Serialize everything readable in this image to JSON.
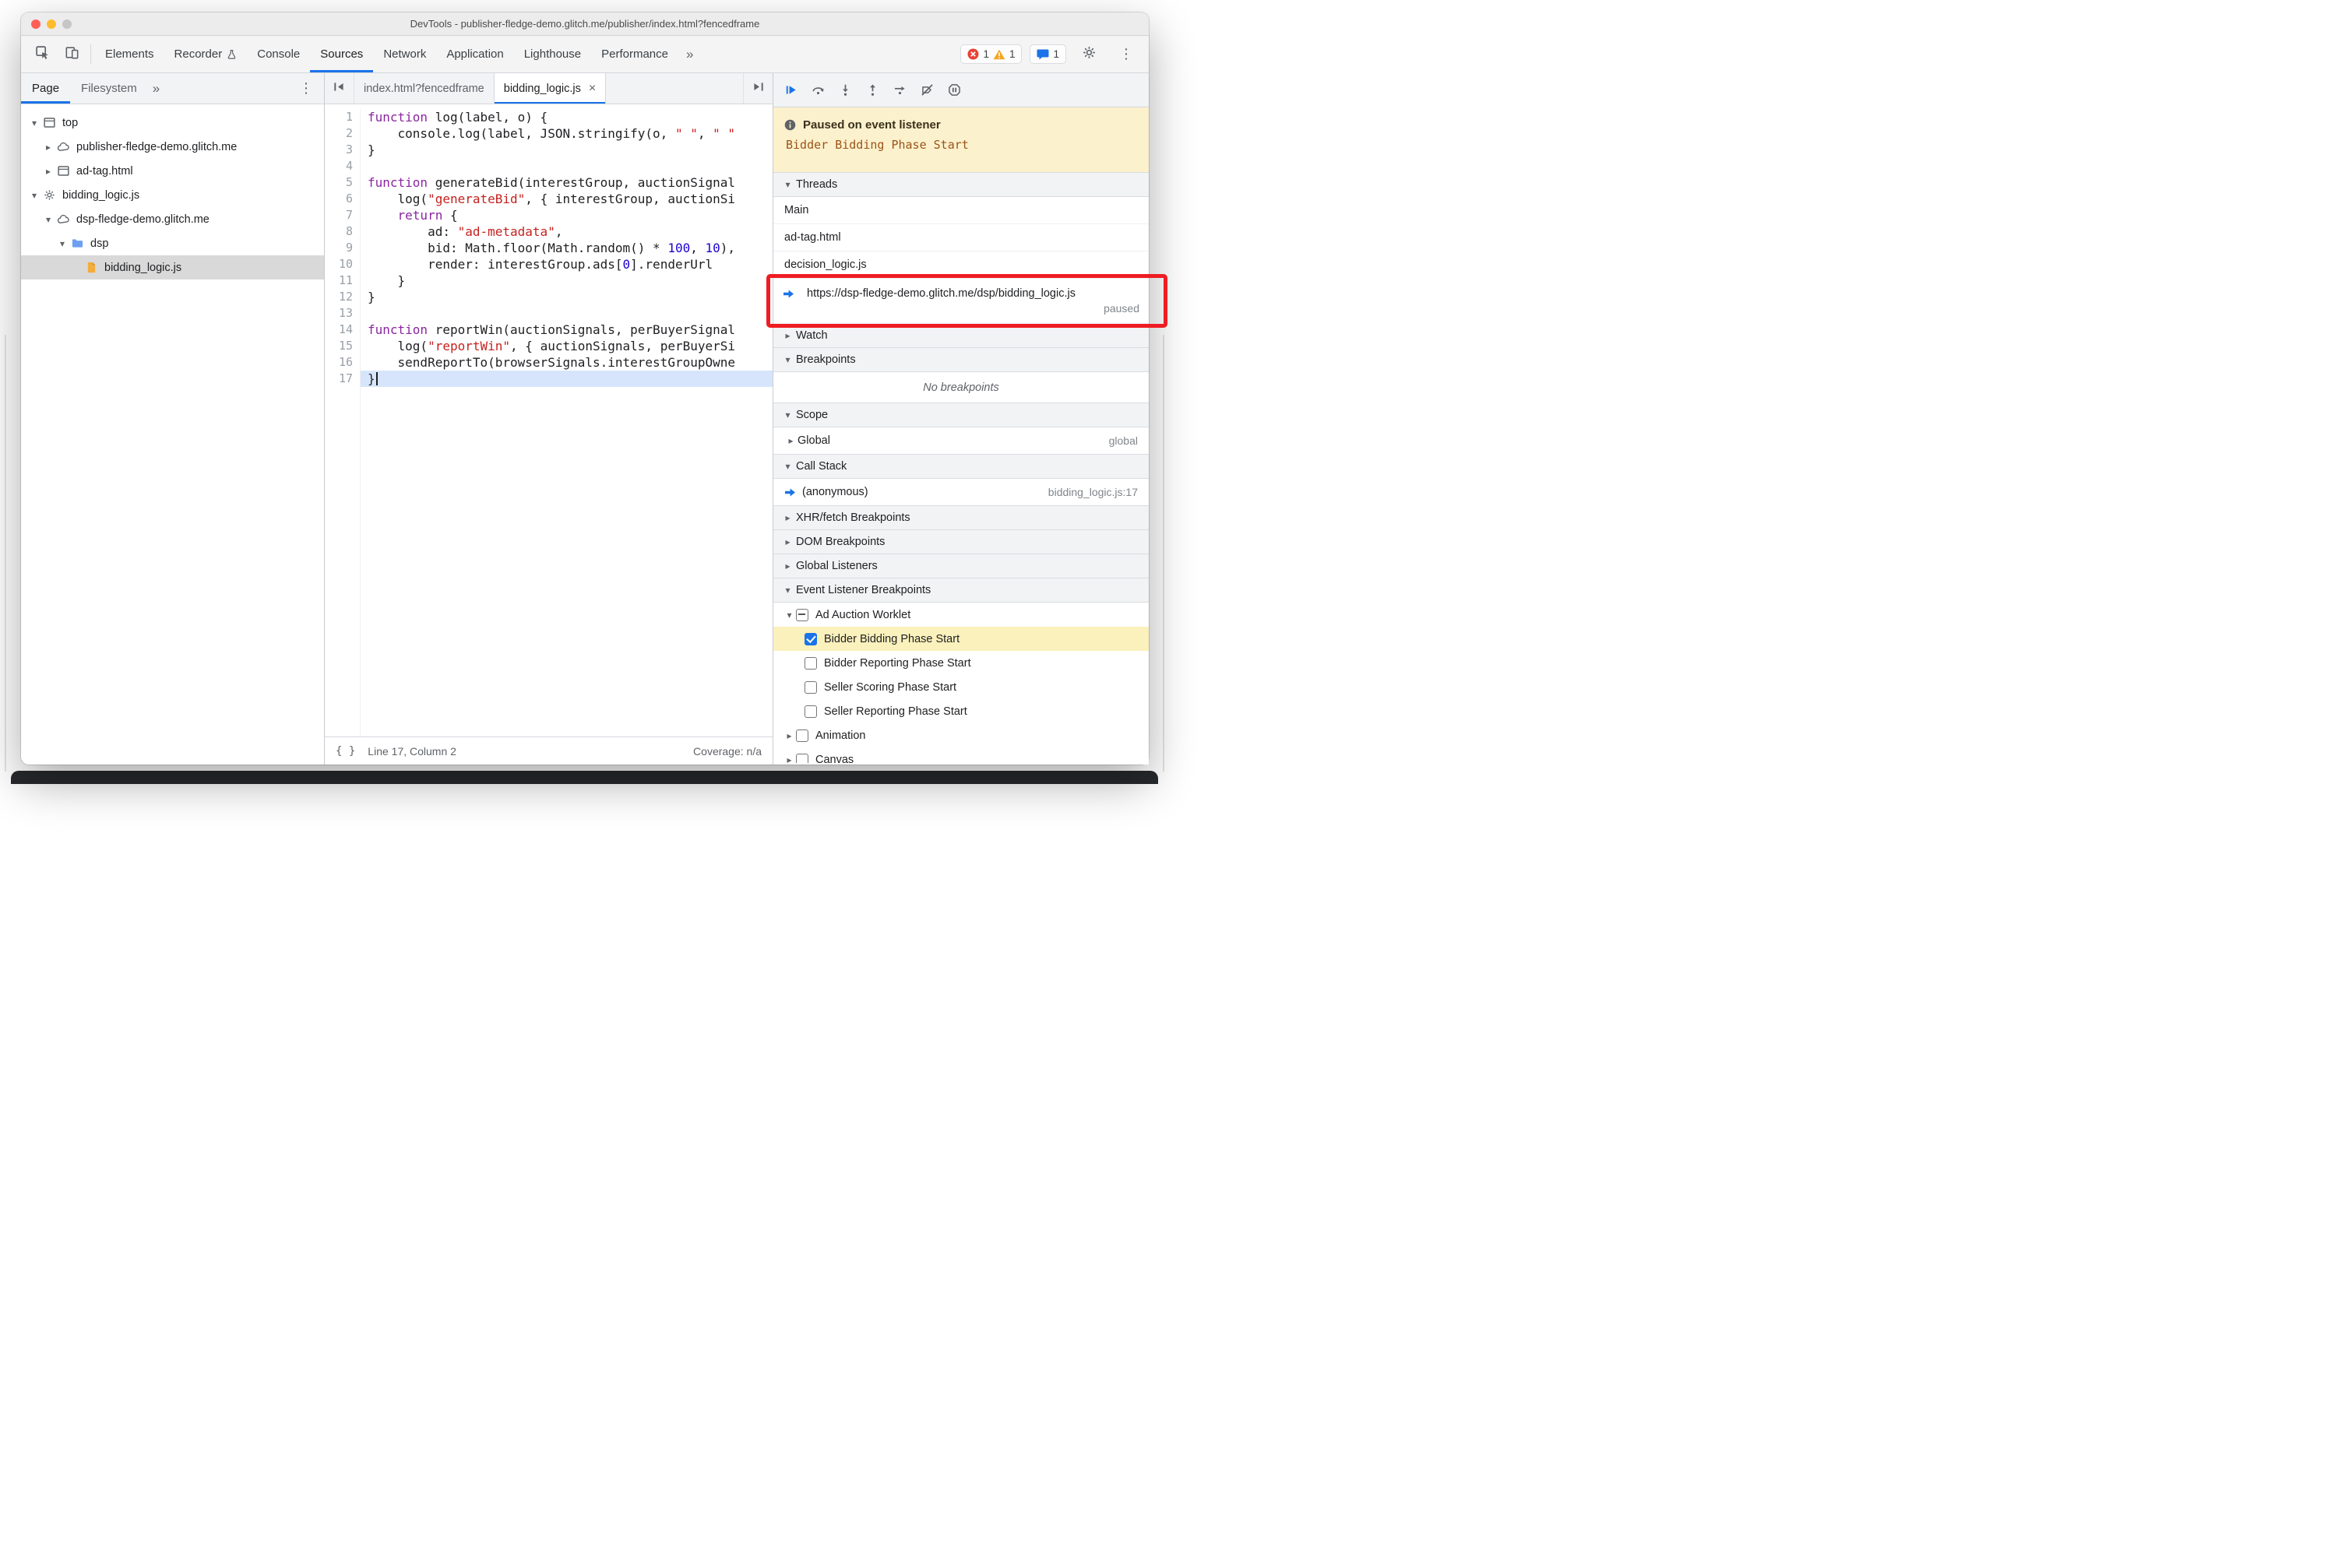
{
  "colors": {
    "accent": "#1a73e8",
    "annotation_red": "#ee1d23",
    "banner_bg": "#fcf1cd",
    "banner_detail": "#9a5518",
    "highlight_yellow": "#fbf1bc",
    "line_highlight": "#d6e5fb",
    "error_red": "#e94235",
    "warning_yellow": "#f5a623",
    "traffic_red": "#ff5f57",
    "traffic_yellow": "#febc2e",
    "traffic_gray": "#c6c6c4"
  },
  "window": {
    "title": "DevTools - publisher-fledge-demo.glitch.me/publisher/index.html?fencedframe"
  },
  "toolbar": {
    "tabs": [
      {
        "label": "Elements"
      },
      {
        "label": "Recorder",
        "badge": "flask"
      },
      {
        "label": "Console"
      },
      {
        "label": "Sources",
        "active": true
      },
      {
        "label": "Network"
      },
      {
        "label": "Application"
      },
      {
        "label": "Lighthouse"
      },
      {
        "label": "Performance"
      }
    ],
    "more": "»",
    "menu": "⋮",
    "error_count": "1",
    "warning_count": "1",
    "issues_count": "1"
  },
  "sidebar": {
    "tabs": [
      {
        "label": "Page",
        "active": true
      },
      {
        "label": "Filesystem"
      }
    ],
    "more": "»",
    "menu": "⋮",
    "tree": [
      {
        "indent": 0,
        "arrow": "down",
        "icon": "frame",
        "label": "top"
      },
      {
        "indent": 1,
        "arrow": "right",
        "icon": "cloud",
        "label": "publisher-fledge-demo.glitch.me"
      },
      {
        "indent": 1,
        "arrow": "right",
        "icon": "frame",
        "label": "ad-tag.html"
      },
      {
        "indent": 0,
        "arrow": "down",
        "icon": "gear",
        "label": "bidding_logic.js"
      },
      {
        "indent": 1,
        "arrow": "down",
        "icon": "cloud",
        "label": "dsp-fledge-demo.glitch.me"
      },
      {
        "indent": 2,
        "arrow": "down",
        "icon": "folder",
        "label": "dsp"
      },
      {
        "indent": 3,
        "arrow": "none",
        "icon": "file-js",
        "label": "bidding_logic.js",
        "selected": true
      }
    ]
  },
  "editor": {
    "tabs": [
      {
        "label": "index.html?fencedframe"
      },
      {
        "label": "bidding_logic.js",
        "active": true,
        "closable": true
      }
    ],
    "tab_close": "×",
    "lines": [
      {
        "n": "1",
        "segs": [
          [
            "kw",
            "function"
          ],
          [
            "pl",
            " log(label, o) {"
          ]
        ]
      },
      {
        "n": "2",
        "segs": [
          [
            "pl",
            "    console.log(label, JSON.stringify(o, "
          ],
          [
            "str",
            "\" \""
          ],
          [
            "pl",
            ", "
          ],
          [
            "str",
            "\" \""
          ]
        ]
      },
      {
        "n": "3",
        "segs": [
          [
            "pl",
            "}"
          ]
        ]
      },
      {
        "n": "4",
        "segs": []
      },
      {
        "n": "5",
        "segs": [
          [
            "kw",
            "function"
          ],
          [
            "pl",
            " generateBid(interestGroup, auctionSignal"
          ]
        ]
      },
      {
        "n": "6",
        "segs": [
          [
            "pl",
            "    log("
          ],
          [
            "str",
            "\"generateBid\""
          ],
          [
            "pl",
            ", { interestGroup, auctionSi"
          ]
        ]
      },
      {
        "n": "7",
        "segs": [
          [
            "pl",
            "    "
          ],
          [
            "kw",
            "return"
          ],
          [
            "pl",
            " {"
          ]
        ]
      },
      {
        "n": "8",
        "segs": [
          [
            "pl",
            "        ad: "
          ],
          [
            "str",
            "\"ad-metadata\""
          ],
          [
            "pl",
            ","
          ]
        ]
      },
      {
        "n": "9",
        "segs": [
          [
            "pl",
            "        bid: Math.floor(Math.random() * "
          ],
          [
            "num",
            "100"
          ],
          [
            "pl",
            ", "
          ],
          [
            "num",
            "10"
          ],
          [
            "pl",
            "),"
          ]
        ]
      },
      {
        "n": "10",
        "segs": [
          [
            "pl",
            "        render: interestGroup.ads["
          ],
          [
            "num",
            "0"
          ],
          [
            "pl",
            "].renderUrl"
          ]
        ]
      },
      {
        "n": "11",
        "segs": [
          [
            "pl",
            "    }"
          ]
        ]
      },
      {
        "n": "12",
        "segs": [
          [
            "pl",
            "}"
          ]
        ]
      },
      {
        "n": "13",
        "segs": []
      },
      {
        "n": "14",
        "segs": [
          [
            "kw",
            "function"
          ],
          [
            "pl",
            " reportWin(auctionSignals, perBuyerSignal"
          ]
        ]
      },
      {
        "n": "15",
        "segs": [
          [
            "pl",
            "    log("
          ],
          [
            "str",
            "\"reportWin\""
          ],
          [
            "pl",
            ", { auctionSignals, perBuyerSi"
          ]
        ]
      },
      {
        "n": "16",
        "segs": [
          [
            "pl",
            "    sendReportTo(browserSignals.interestGroupOwne"
          ]
        ]
      },
      {
        "n": "17",
        "segs": [
          [
            "pl",
            "}"
          ]
        ],
        "current": true,
        "caret": true
      }
    ],
    "status": {
      "format_icon": "{ }",
      "line_col": "Line 17, Column 2",
      "coverage": "Coverage: n/a"
    }
  },
  "debugger": {
    "toolbar_icons": [
      "resume",
      "step-over",
      "step-into",
      "step-out",
      "step",
      "deactivate-breakpoints",
      "pause-on-exceptions"
    ],
    "paused_banner": {
      "title": "Paused on event listener",
      "detail": "Bidder Bidding Phase Start"
    },
    "threads": {
      "title": "Threads",
      "items": [
        {
          "label": "Main"
        },
        {
          "label": "ad-tag.html"
        },
        {
          "label": "decision_logic.js"
        },
        {
          "label": "https://dsp-fledge-demo.glitch.me/dsp/bidding_logic.js",
          "status": "paused",
          "annotated": true
        }
      ]
    },
    "watch": {
      "title": "Watch"
    },
    "breakpoints": {
      "title": "Breakpoints",
      "empty": "No breakpoints"
    },
    "scope": {
      "title": "Scope",
      "rows": [
        {
          "label": "Global",
          "value": "global"
        }
      ]
    },
    "call_stack": {
      "title": "Call Stack",
      "rows": [
        {
          "label": "(anonymous)",
          "location": "bidding_logic.js:17",
          "current": true
        }
      ]
    },
    "collapsed_sections": [
      "XHR/fetch Breakpoints",
      "DOM Breakpoints",
      "Global Listeners"
    ],
    "event_listener_breakpoints": {
      "title": "Event Listener Breakpoints",
      "groups": [
        {
          "label": "Ad Auction Worklet",
          "expanded": true,
          "checkbox": "indeterminate",
          "items": [
            {
              "label": "Bidder Bidding Phase Start",
              "checked": true,
              "highlighted": true
            },
            {
              "label": "Bidder Reporting Phase Start",
              "checked": false
            },
            {
              "label": "Seller Scoring Phase Start",
              "checked": false
            },
            {
              "label": "Seller Reporting Phase Start",
              "checked": false
            }
          ]
        },
        {
          "label": "Animation",
          "expanded": false,
          "checkbox": "unchecked",
          "items": []
        },
        {
          "label": "Canvas",
          "expanded": false,
          "checkbox": "unchecked",
          "items": [],
          "clipped": true
        }
      ]
    }
  }
}
